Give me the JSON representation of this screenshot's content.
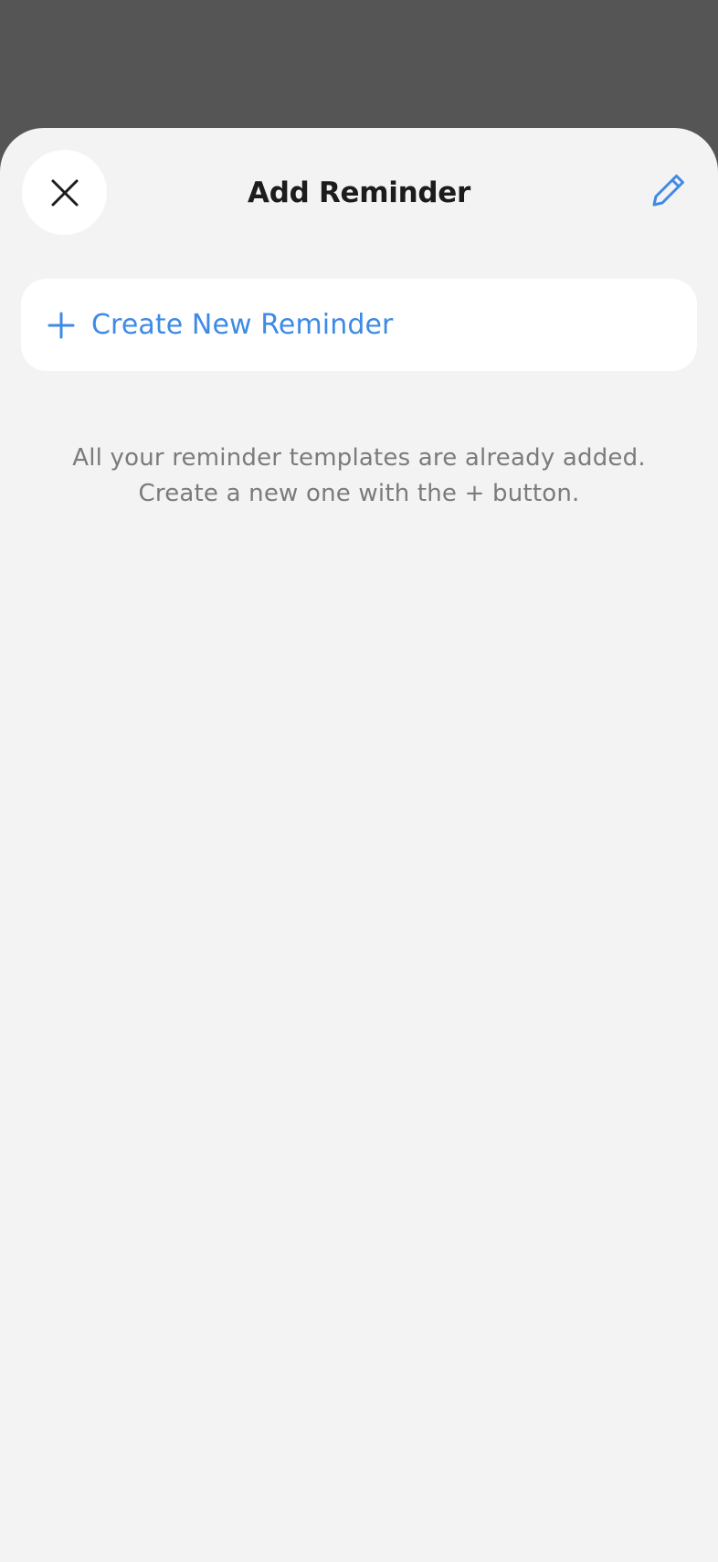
{
  "header": {
    "title": "Add Reminder",
    "close_icon": "close-icon",
    "edit_icon": "pencil-icon"
  },
  "create_card": {
    "icon": "plus-icon",
    "label": "Create New Reminder"
  },
  "empty_state": {
    "line1": "All your reminder templates are already added.",
    "line2": "Create a new one with the + button."
  },
  "colors": {
    "accent": "#3e8ae6",
    "backdrop": "#555555",
    "sheet": "#f3f3f4",
    "card": "#ffffff",
    "title_text": "#1c1c1e",
    "muted_text": "#7b7b7d"
  }
}
